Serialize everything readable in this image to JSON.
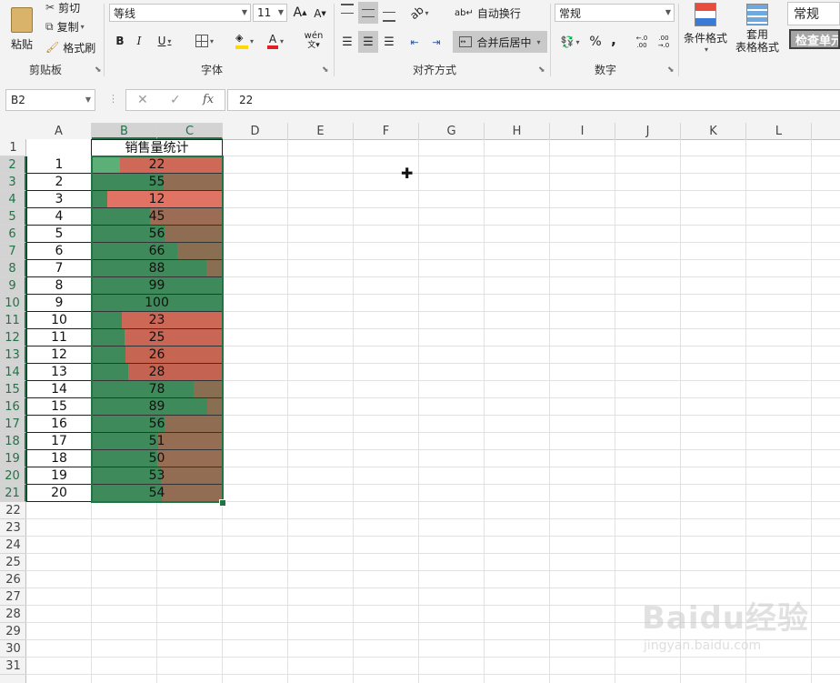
{
  "ribbon": {
    "clipboard": {
      "label": "剪贴板",
      "paste": "粘贴",
      "cut": "剪切",
      "copy": "复制",
      "format_painter": "格式刷"
    },
    "font": {
      "label": "字体",
      "font_name": "等线",
      "font_size": "11",
      "bold": "B",
      "italic": "I",
      "underline": "U",
      "grow": "A",
      "shrink": "A",
      "phonetic": "wén"
    },
    "alignment": {
      "label": "对齐方式",
      "wrap_text": "自动换行",
      "merge_center": "合并后居中"
    },
    "number": {
      "label": "数字",
      "format": "常规",
      "percent": "%",
      "comma": ",",
      "inc_decimal": "←.0 .00",
      "dec_decimal": ".00 →.0"
    },
    "styles": {
      "conditional_format": "条件格式",
      "table_format_line1": "套用",
      "table_format_line2": "表格格式",
      "style_normal": "常规",
      "style_check": "检查单元"
    }
  },
  "formula_bar": {
    "name_box": "B2",
    "formula": "22",
    "cancel": "✕",
    "enter": "✓",
    "fx": "fx"
  },
  "columns": [
    "A",
    "B",
    "C",
    "D",
    "E",
    "F",
    "G",
    "H",
    "I",
    "J",
    "K",
    "L"
  ],
  "rows": [
    "1",
    "2",
    "3",
    "4",
    "5",
    "6",
    "7",
    "8",
    "9",
    "10",
    "11",
    "12",
    "13",
    "14",
    "15",
    "16",
    "17",
    "18",
    "19",
    "20",
    "21",
    "22",
    "23",
    "24",
    "25",
    "26",
    "27",
    "28",
    "29",
    "30",
    "31"
  ],
  "sheet": {
    "title": "销售量统计",
    "index_values": [
      "1",
      "2",
      "3",
      "4",
      "5",
      "6",
      "7",
      "8",
      "9",
      "10",
      "11",
      "12",
      "13",
      "14",
      "15",
      "16",
      "17",
      "18",
      "19",
      "20"
    ],
    "sales_values": [
      22,
      55,
      12,
      45,
      56,
      66,
      88,
      99,
      100,
      23,
      25,
      26,
      28,
      78,
      89,
      56,
      51,
      50,
      53,
      54
    ],
    "data_bar_max": 100,
    "colors": {
      "bar_green": "#3f8a5a",
      "bar_green_light": "#5cb077",
      "low_red": "#e47565",
      "mid_brown": "#8a6e52",
      "selection": "#217346"
    }
  },
  "watermark": {
    "logo": "Baidu经验",
    "url": "jingyan.baidu.com"
  }
}
